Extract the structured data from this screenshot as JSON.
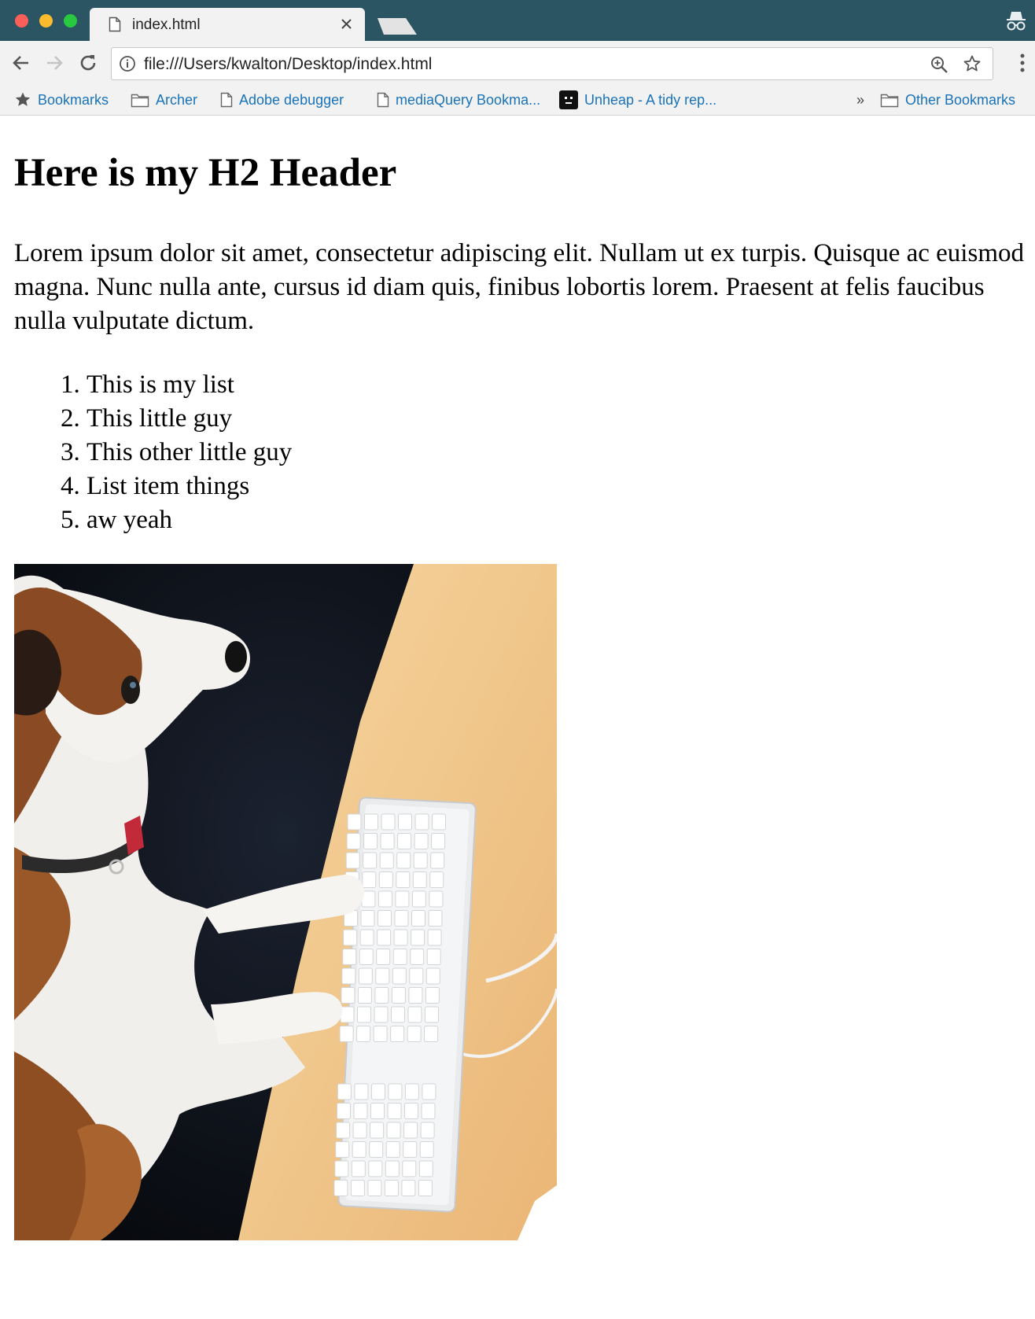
{
  "browser": {
    "tab_title": "index.html",
    "url": "file:///Users/kwalton/Desktop/index.html"
  },
  "bookmarks": [
    {
      "label": "Bookmarks",
      "icon": "star-icon"
    },
    {
      "label": "Archer",
      "icon": "folder-icon"
    },
    {
      "label": "Adobe debugger",
      "icon": "page-icon"
    },
    {
      "label": "mediaQuery Bookma...",
      "icon": "page-icon"
    },
    {
      "label": "Unheap - A tidy rep...",
      "icon": "unheap-favicon"
    }
  ],
  "bookmarks_overflow": "»",
  "other_bookmarks": {
    "label": "Other Bookmarks",
    "icon": "folder-icon"
  },
  "page": {
    "heading": "Here is my H2 Header",
    "paragraph": "Lorem ipsum dolor sit amet, consectetur adipiscing elit. Nullam ut ex turpis. Quisque ac euismod magna. Nunc nulla ante, cursus id diam quis, finibus lobortis lorem. Praesent at felis faucibus nulla vulputate dictum.",
    "list": [
      "This is my list",
      "This little guy",
      "This other little guy",
      "List item things",
      "aw yeah"
    ]
  },
  "colors": {
    "titlebar": "#2c5564",
    "toolbar": "#f2f2f2",
    "bookmark_link": "#1a73b8"
  }
}
